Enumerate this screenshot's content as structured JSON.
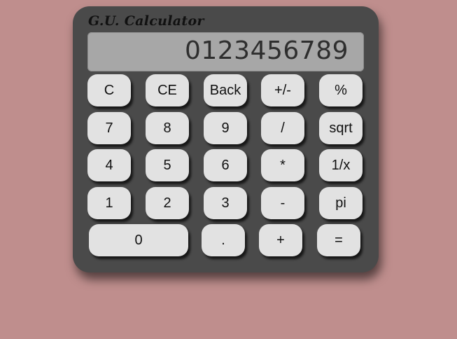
{
  "title": "G.U. Calculator",
  "display": {
    "value": "0123456789"
  },
  "rows": [
    [
      "C",
      "CE",
      "Back",
      "+/-",
      "%"
    ],
    [
      "7",
      "8",
      "9",
      "/",
      "sqrt"
    ],
    [
      "4",
      "5",
      "6",
      "*",
      "1/x"
    ],
    [
      "1",
      "2",
      "3",
      "-",
      "pi"
    ],
    [
      "0",
      ".",
      "+",
      "="
    ]
  ]
}
